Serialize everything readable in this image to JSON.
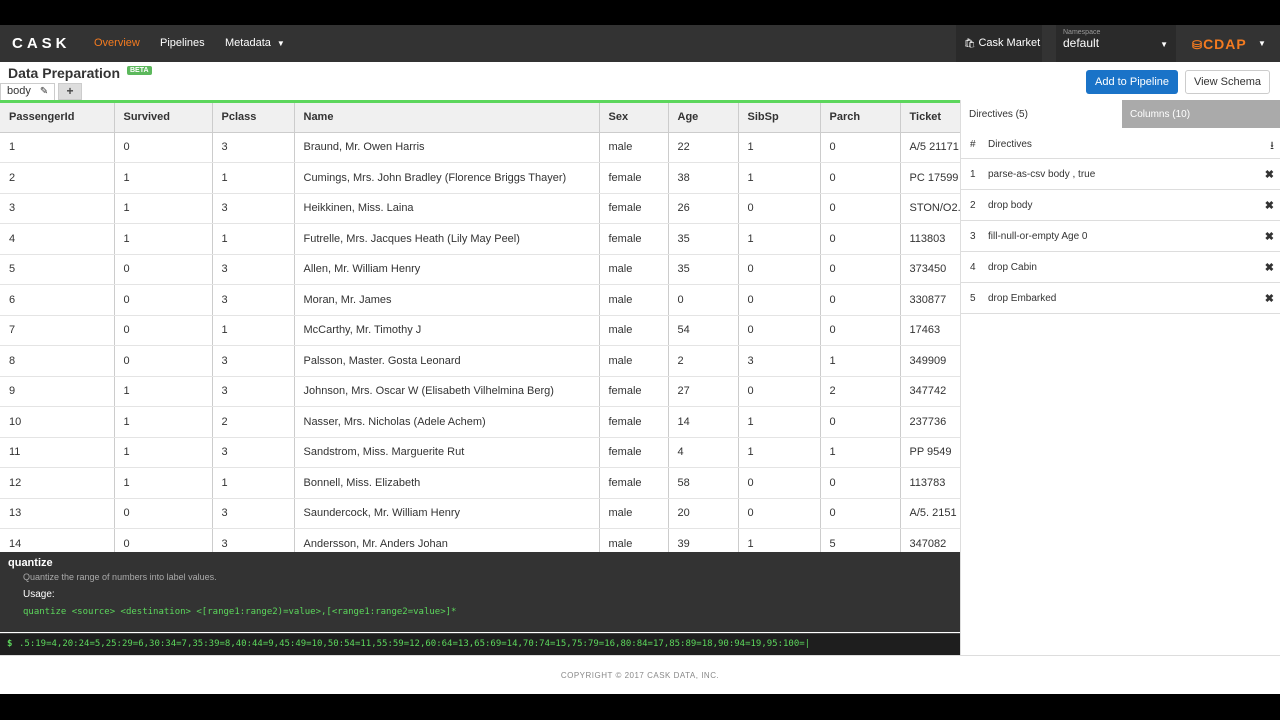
{
  "nav": {
    "brand": "CASK",
    "links": [
      "Overview",
      "Pipelines",
      "Metadata"
    ],
    "market": "Cask Market",
    "namespace_label": "Namespace",
    "namespace_value": "default",
    "product": "CDAP",
    "accent": "#f47b20"
  },
  "page": {
    "title": "Data Preparation",
    "badge": "BETA",
    "tab": "body",
    "add_to_pipeline": "Add to Pipeline",
    "view_schema": "View Schema"
  },
  "grid": {
    "columns": [
      "PassengerId",
      "Survived",
      "Pclass",
      "Name",
      "Sex",
      "Age",
      "SibSp",
      "Parch",
      "Ticket"
    ],
    "rows": [
      [
        "1",
        "0",
        "3",
        "Braund, Mr. Owen Harris",
        "male",
        "22",
        "1",
        "0",
        "A/5 21171"
      ],
      [
        "2",
        "1",
        "1",
        "Cumings, Mrs. John Bradley (Florence Briggs Thayer)",
        "female",
        "38",
        "1",
        "0",
        "PC 17599"
      ],
      [
        "3",
        "1",
        "3",
        "Heikkinen, Miss. Laina",
        "female",
        "26",
        "0",
        "0",
        "STON/O2."
      ],
      [
        "4",
        "1",
        "1",
        "Futrelle, Mrs. Jacques Heath (Lily May Peel)",
        "female",
        "35",
        "1",
        "0",
        "113803"
      ],
      [
        "5",
        "0",
        "3",
        "Allen, Mr. William Henry",
        "male",
        "35",
        "0",
        "0",
        "373450"
      ],
      [
        "6",
        "0",
        "3",
        "Moran, Mr. James",
        "male",
        "0",
        "0",
        "0",
        "330877"
      ],
      [
        "7",
        "0",
        "1",
        "McCarthy, Mr. Timothy J",
        "male",
        "54",
        "0",
        "0",
        "17463"
      ],
      [
        "8",
        "0",
        "3",
        "Palsson, Master. Gosta Leonard",
        "male",
        "2",
        "3",
        "1",
        "349909"
      ],
      [
        "9",
        "1",
        "3",
        "Johnson, Mrs. Oscar W (Elisabeth Vilhelmina Berg)",
        "female",
        "27",
        "0",
        "2",
        "347742"
      ],
      [
        "10",
        "1",
        "2",
        "Nasser, Mrs. Nicholas (Adele Achem)",
        "female",
        "14",
        "1",
        "0",
        "237736"
      ],
      [
        "11",
        "1",
        "3",
        "Sandstrom, Miss. Marguerite Rut",
        "female",
        "4",
        "1",
        "1",
        "PP 9549"
      ],
      [
        "12",
        "1",
        "1",
        "Bonnell, Miss. Elizabeth",
        "female",
        "58",
        "0",
        "0",
        "113783"
      ],
      [
        "13",
        "0",
        "3",
        "Saundercock, Mr. William Henry",
        "male",
        "20",
        "0",
        "0",
        "A/5. 2151"
      ],
      [
        "14",
        "0",
        "3",
        "Andersson, Mr. Anders Johan",
        "male",
        "39",
        "1",
        "5",
        "347082"
      ]
    ]
  },
  "help": {
    "name": "quantize",
    "description": "Quantize the range of numbers into label values.",
    "usage_label": "Usage:",
    "syntax": "quantize <source> <destination> <[range1:range2)=value>,[<range1:range2=value>]*"
  },
  "command": {
    "prompt": "$",
    "text": ".5:19=4,20:24=5,25:29=6,30:34=7,35:39=8,40:44=9,45:49=10,50:54=11,55:59=12,60:64=13,65:69=14,70:74=15,75:79=16,80:84=17,85:89=18,90:94=19,95:100=|"
  },
  "right_panel": {
    "tab_directives": "Directives (5)",
    "tab_columns": "Columns (10)",
    "header_hash": "#",
    "header_label": "Directives",
    "directives": [
      {
        "num": "1",
        "text": "parse-as-csv body , true"
      },
      {
        "num": "2",
        "text": "drop body"
      },
      {
        "num": "3",
        "text": "fill-null-or-empty Age 0"
      },
      {
        "num": "4",
        "text": "drop Cabin"
      },
      {
        "num": "5",
        "text": "drop Embarked"
      }
    ]
  },
  "footer": {
    "copyright": "COPYRIGHT © 2017 CASK DATA, INC."
  }
}
